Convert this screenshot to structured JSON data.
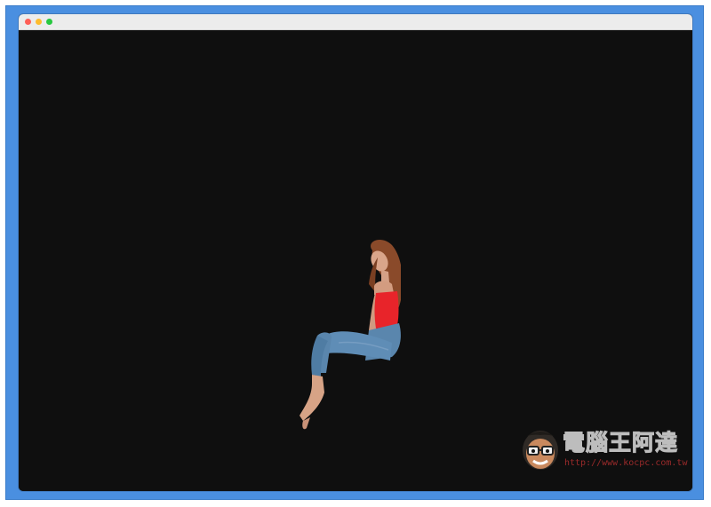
{
  "window": {
    "controls": [
      {
        "name": "close",
        "color": "#ff5f57"
      },
      {
        "name": "minimize",
        "color": "#febc2e"
      },
      {
        "name": "maximize",
        "color": "#28c840"
      }
    ],
    "background_color": "#0f0f0f",
    "frame_color": "#4a8fe0"
  },
  "content": {
    "subject": "person-cutout-image"
  },
  "watermark": {
    "title": "電腦王阿達",
    "url": "http://www.kocpc.com.tw"
  }
}
